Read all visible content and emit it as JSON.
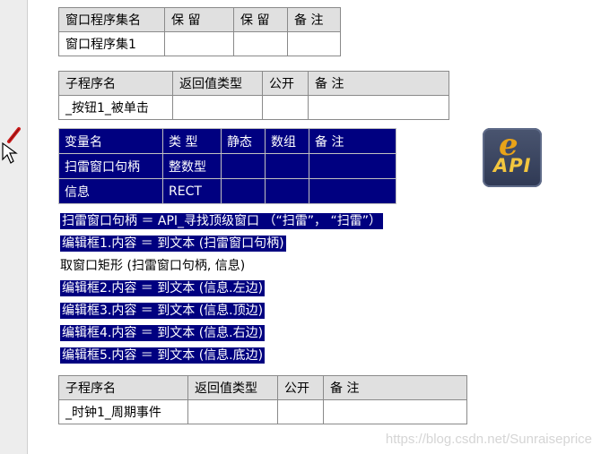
{
  "program_set_table": {
    "headers": [
      "窗口程序集名",
      "保 留",
      "保 留",
      "备 注"
    ],
    "row": [
      "窗口程序集1",
      "",
      "",
      ""
    ]
  },
  "sub1_table": {
    "headers": [
      "子程序名",
      "返回值类型",
      "公开",
      "备 注"
    ],
    "row": [
      "_按钮1_被单击",
      "",
      "",
      ""
    ]
  },
  "var_table": {
    "headers": [
      "变量名",
      "类 型",
      "静态",
      "数组",
      "备 注"
    ],
    "rows": [
      [
        "扫雷窗口句柄",
        "整数型",
        "",
        "",
        ""
      ],
      [
        "信息",
        "RECT",
        "",
        "",
        ""
      ]
    ]
  },
  "code_lines": [
    "扫雷窗口句柄 ＝ API_寻找顶级窗口 （“扫雷”， “扫雷”）",
    "编辑框1.内容 ＝ 到文本 (扫雷窗口句柄)",
    "取窗口矩形 (扫雷窗口句柄, 信息)",
    "编辑框2.内容 ＝ 到文本 (信息.左边)",
    "编辑框3.内容 ＝ 到文本 (信息.顶边)",
    "编辑框4.内容 ＝ 到文本 (信息.右边)",
    "编辑框5.内容 ＝ 到文本 (信息.底边)"
  ],
  "sub2_table": {
    "headers": [
      "子程序名",
      "返回值类型",
      "公开",
      "备 注"
    ],
    "row": [
      "_时钟1_周期事件",
      "",
      "",
      ""
    ]
  },
  "logo": {
    "letter": "e",
    "text": "API"
  },
  "watermark": "https://blog.csdn.net/Sunraiseprice",
  "colors": {
    "selection": "#000080",
    "header_bg": "#e0e0e0",
    "logo_bg": "#2f3954",
    "logo_text": "#f3c63f"
  }
}
